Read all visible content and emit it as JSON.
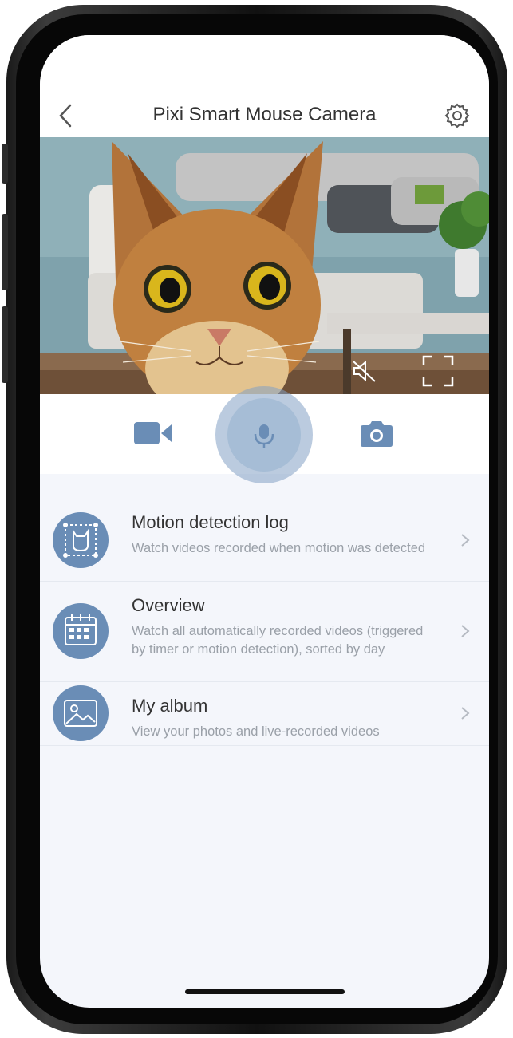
{
  "header": {
    "title": "Pixi Smart Mouse Camera",
    "back_icon": "chevron-left-icon",
    "settings_icon": "gear-icon"
  },
  "video": {
    "mute_icon": "speaker-muted-icon",
    "fullscreen_icon": "fullscreen-icon"
  },
  "controls": {
    "record_icon": "video-camera-icon",
    "mic_icon": "microphone-icon",
    "snapshot_icon": "camera-icon"
  },
  "menu": {
    "items": [
      {
        "title": "Motion detection log",
        "description": "Watch videos recorded when motion was detected",
        "icon": "motion-detection-icon"
      },
      {
        "title": "Overview",
        "description": "Watch all automatically recorded videos (triggered by timer or motion detection), sorted by day",
        "icon": "calendar-icon"
      },
      {
        "title": "My album",
        "description": "View your photos and live-recorded videos",
        "icon": "photo-album-icon"
      }
    ]
  },
  "colors": {
    "accent": "#6a8db6",
    "mic": "#a6bdd6",
    "background": "#f4f6fb"
  }
}
